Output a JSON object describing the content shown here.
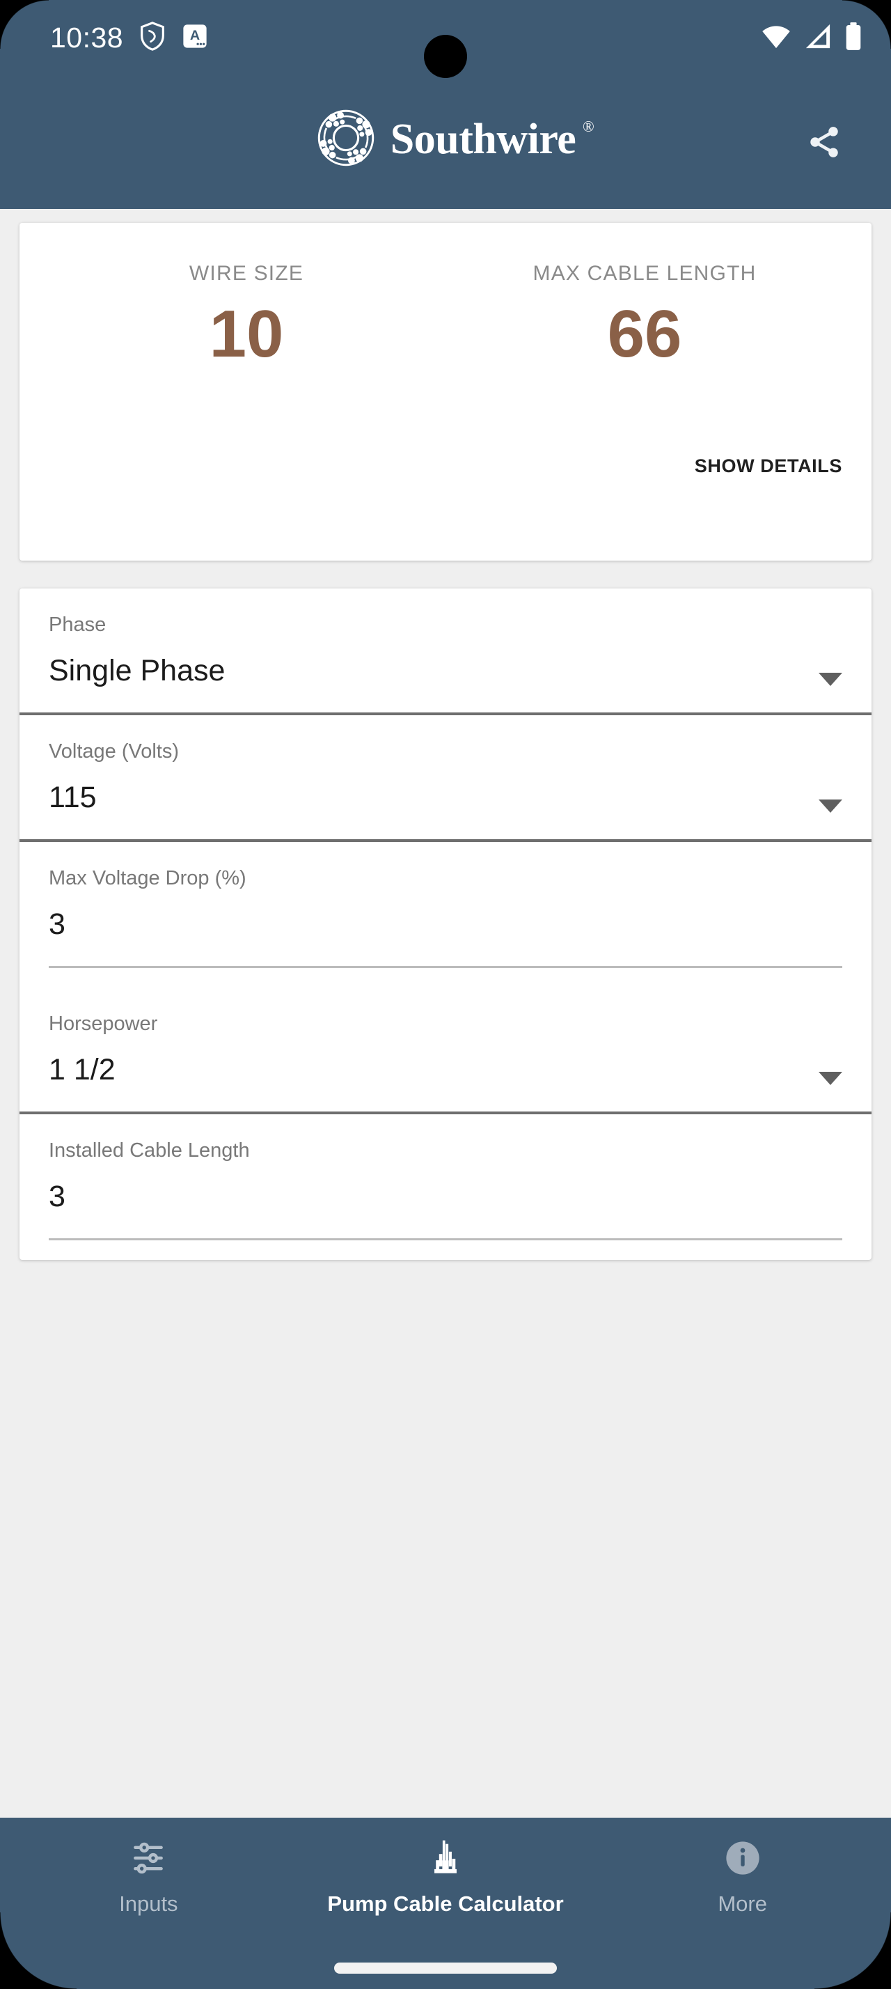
{
  "status_bar": {
    "time": "10:38",
    "icons": [
      "shield-icon",
      "app-badge-a-icon",
      "wifi-icon",
      "cellular-signal-icon",
      "battery-icon"
    ],
    "app_badge_letter": "A"
  },
  "app_bar": {
    "brand": "Southwire",
    "brand_registered": "®",
    "share_label": "Share"
  },
  "results": {
    "wire_size_label": "WIRE SIZE",
    "wire_size_value": "10",
    "max_cable_length_label": "MAX CABLE LENGTH",
    "max_cable_length_value": "66",
    "show_details_label": "SHOW DETAILS",
    "value_color": "#8a6047"
  },
  "form": {
    "fields": [
      {
        "label": "Phase",
        "value": "Single Phase",
        "type": "dropdown"
      },
      {
        "label": "Voltage (Volts)",
        "value": "115",
        "type": "dropdown"
      },
      {
        "label": "Max Voltage Drop (%)",
        "value": "3",
        "type": "text"
      },
      {
        "label": "Horsepower",
        "value": "1 1/2",
        "type": "dropdown"
      },
      {
        "label": "Installed Cable Length",
        "value": "3",
        "type": "text"
      }
    ]
  },
  "bottom_nav": {
    "items": [
      {
        "label": "Inputs",
        "icon": "sliders-icon",
        "active": false
      },
      {
        "label": "Pump Cable Calculator",
        "icon": "pump-icon",
        "active": true
      },
      {
        "label": "More",
        "icon": "info-icon",
        "active": false
      }
    ]
  },
  "theme": {
    "header_blue": "#3e5a73",
    "page_background": "#efefef",
    "accent_brown": "#8a6047"
  }
}
